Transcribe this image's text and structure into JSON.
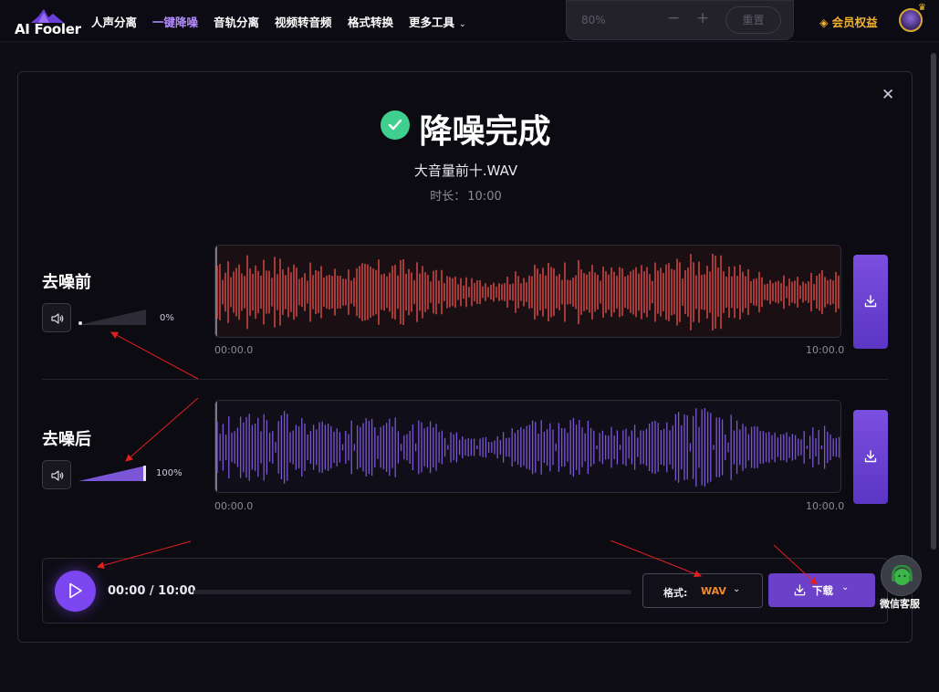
{
  "nav": {
    "logo": "AI Fooler",
    "items": [
      {
        "label": "人声分离",
        "active": false
      },
      {
        "label": "一键降噪",
        "active": true
      },
      {
        "label": "音轨分离",
        "active": false
      },
      {
        "label": "视频转音频",
        "active": false
      },
      {
        "label": "格式转换",
        "active": false
      },
      {
        "label": "更多工具",
        "active": false
      }
    ],
    "more_chevron": "chevron-down-icon",
    "vip_label": "会员权益",
    "vip_icon": "diamond-icon"
  },
  "zoom": {
    "value": "80%",
    "minus": "−",
    "plus": "+",
    "reset_label": "重置"
  },
  "modal": {
    "title": "降噪完成",
    "filename": "大音量前十.WAV",
    "duration_label": "时长：",
    "duration_value": "10:00"
  },
  "tracks": {
    "before": {
      "label": "去噪前",
      "volume": "0%",
      "volume_fraction": 0.0,
      "start_time": "00:00.0",
      "end_time": "10:00.0",
      "wave_color": "#f0524f"
    },
    "after": {
      "label": "去噪后",
      "volume": "100%",
      "volume_fraction": 1.0,
      "start_time": "00:00.0",
      "end_time": "10:00.0",
      "wave_color": "#7a55d6"
    }
  },
  "player": {
    "time": "00:00 / 10:00",
    "progress_fraction": 0.0,
    "format_label": "格式:",
    "format_value": "WAV",
    "download_label": "下载"
  },
  "support": {
    "label": "微信客服"
  },
  "colors": {
    "accent": "#7c47f0",
    "success": "#3fcf8e",
    "format": "#f28a2c",
    "vip": "#f2b230"
  }
}
